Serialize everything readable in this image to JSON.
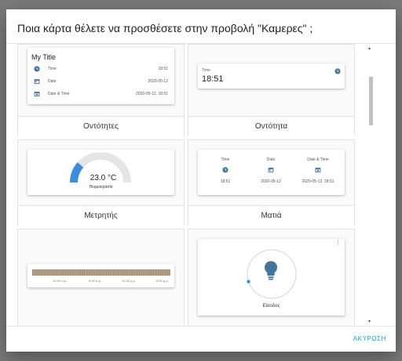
{
  "dialog": {
    "title": "Ποια κάρτα θέλετε να προσθέσετε στην προβολή \"Καμερες\" ;",
    "cancel_label": "ΑΚΥΡΩΣΗ"
  },
  "colors": {
    "accent": "#03a9f4",
    "state_icon": "#44739e",
    "gauge_fill": "#3a8ee0",
    "logbook_bar": "#a08a6b"
  },
  "cards": {
    "entities": {
      "label": "Οντότητες",
      "title": "My Title",
      "rows": [
        {
          "name": "Time",
          "value": "18:51",
          "icon": "clock-icon"
        },
        {
          "name": "Date",
          "value": "2020-05-12",
          "icon": "calendar-icon"
        },
        {
          "name": "Date & Time",
          "value": "2020-05-12, 18:51",
          "icon": "calendar-clock-icon"
        }
      ]
    },
    "entity": {
      "label": "Οντότητα",
      "name": "Time",
      "value": "18:51",
      "icon": "clock-icon"
    },
    "gauge": {
      "label": "Μετρητής",
      "value": "23.0 °C",
      "name": "Θερμοκρασία",
      "fraction": 0.23
    },
    "glance": {
      "label": "Ματιά",
      "items": [
        {
          "name": "Time",
          "value": "18:51",
          "icon": "clock-icon"
        },
        {
          "name": "Date",
          "value": "2020-05-12",
          "icon": "calendar-icon"
        },
        {
          "name": "Date & Time",
          "value": "2020-05-12, 18:51",
          "icon": "calendar-clock-icon"
        }
      ]
    },
    "history": {
      "ticks": [
        "12:00 π.μ.",
        "6:00 π.μ.",
        "12:00 μ.μ.",
        "6:00 μ.μ."
      ]
    },
    "light": {
      "name": "Είσοδος",
      "brightness": 0.1,
      "icon": "lightbulb-icon"
    }
  }
}
